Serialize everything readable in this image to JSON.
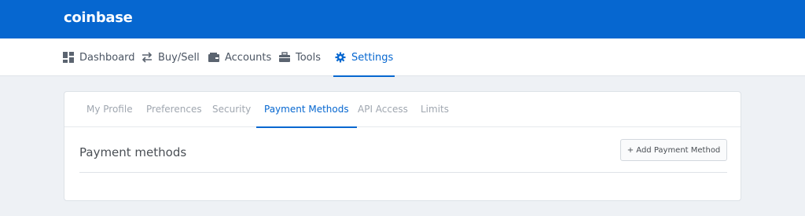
{
  "brand": {
    "logo_text": "coinbase",
    "accent_color": "#0667d0"
  },
  "nav": {
    "items": [
      {
        "label": "Dashboard",
        "icon": "dashboard-icon"
      },
      {
        "label": "Buy/Sell",
        "icon": "exchange-arrows-icon"
      },
      {
        "label": "Accounts",
        "icon": "wallet-icon"
      },
      {
        "label": "Tools",
        "icon": "toolbox-icon"
      },
      {
        "label": "Settings",
        "icon": "gear-icon",
        "active": true
      }
    ]
  },
  "settings_tabs": {
    "items": [
      {
        "label": "My Profile"
      },
      {
        "label": "Preferences"
      },
      {
        "label": "Security"
      },
      {
        "label": "Payment Methods",
        "active": true
      },
      {
        "label": "API Access"
      },
      {
        "label": "Limits"
      }
    ]
  },
  "payment_methods": {
    "title": "Payment methods",
    "add_button_label": "+ Add Payment Method"
  }
}
